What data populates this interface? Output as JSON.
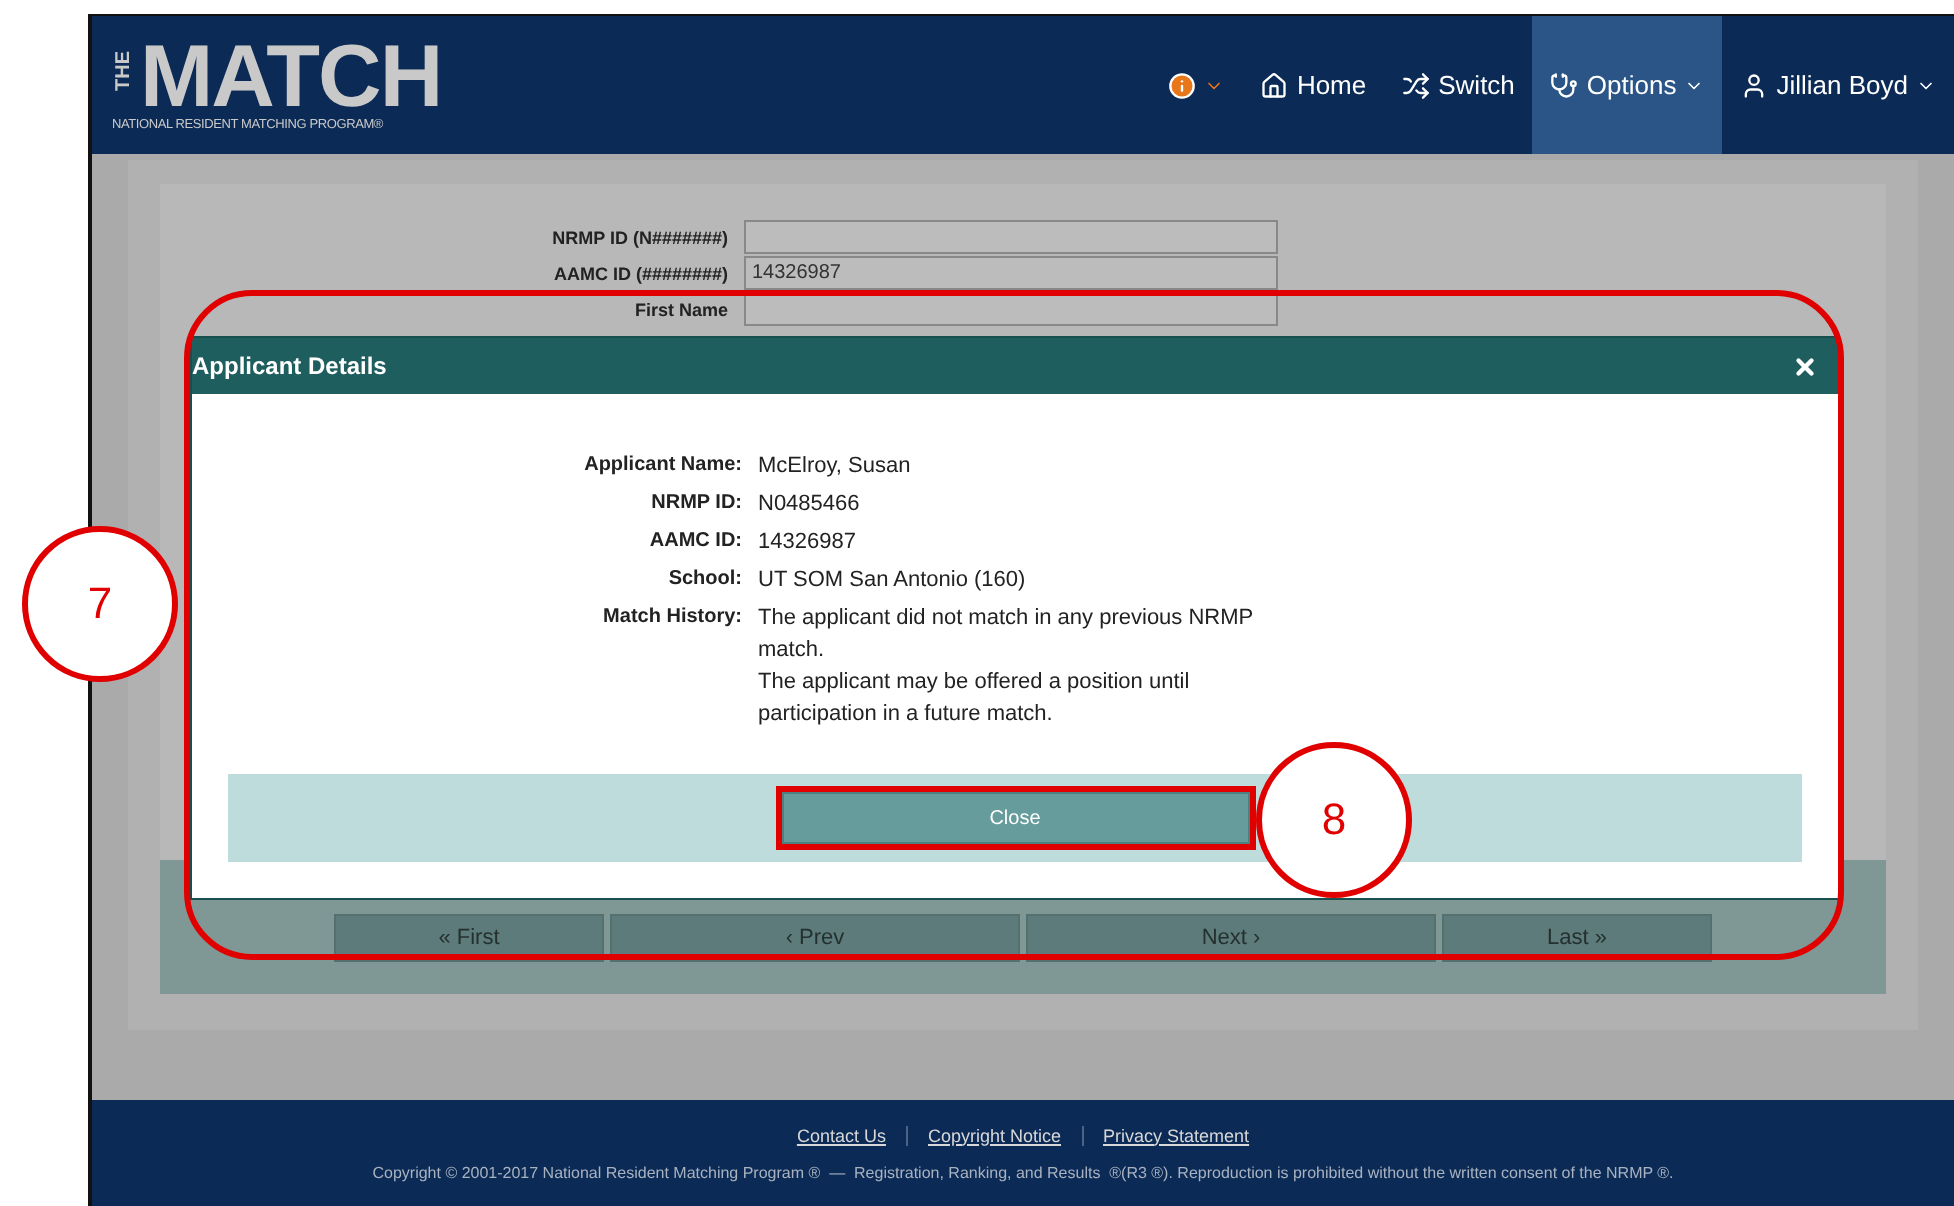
{
  "header": {
    "logo": {
      "vertical": "THE",
      "main": "MATCH",
      "subtitle": "NATIONAL RESIDENT MATCHING PROGRAM®"
    },
    "nav": [
      {
        "kind": "info",
        "caret": true,
        "selected": false
      },
      {
        "kind": "home",
        "label": "Home",
        "caret": false,
        "selected": false
      },
      {
        "kind": "switch",
        "label": "Switch",
        "caret": false,
        "selected": false
      },
      {
        "kind": "options",
        "label": "Options",
        "caret": true,
        "selected": true
      },
      {
        "kind": "user",
        "label": "Jillian Boyd",
        "caret": true,
        "selected": false
      }
    ]
  },
  "form": {
    "fields": [
      {
        "label": "NRMP ID (N#######)"
      },
      {
        "label": "AAMC ID (########)",
        "value": "14326987"
      },
      {
        "label": "First Name"
      }
    ]
  },
  "pager": [
    "« First",
    "‹ Prev",
    "Next ›",
    "Last »"
  ],
  "modal": {
    "title": "Applicant Details",
    "details": [
      {
        "label": "Applicant Name:",
        "lines": [
          "McElroy, Susan"
        ]
      },
      {
        "label": "NRMP ID:",
        "lines": [
          "N0485466"
        ]
      },
      {
        "label": "AAMC ID:",
        "lines": [
          "14326987"
        ]
      },
      {
        "label": "School:",
        "lines": [
          "UT SOM San Antonio (160)"
        ]
      },
      {
        "label": "Match History:",
        "lines": [
          "The applicant did not match in any previous NRMP match.",
          "The applicant may be offered a position until participation in a future match."
        ]
      }
    ],
    "button": "Close"
  },
  "footer": {
    "links": [
      "Contact Us",
      "Copyright Notice",
      "Privacy Statement"
    ],
    "copyright": "Copyright © 2001-2017 National Resident Matching Program ®  —  Registration, Ranking, and Results  ®(R3 ®). Reproduction is prohibited without the written consent of the NRMP ®."
  },
  "callouts": [
    {
      "label": "7"
    },
    {
      "label": "8"
    }
  ]
}
